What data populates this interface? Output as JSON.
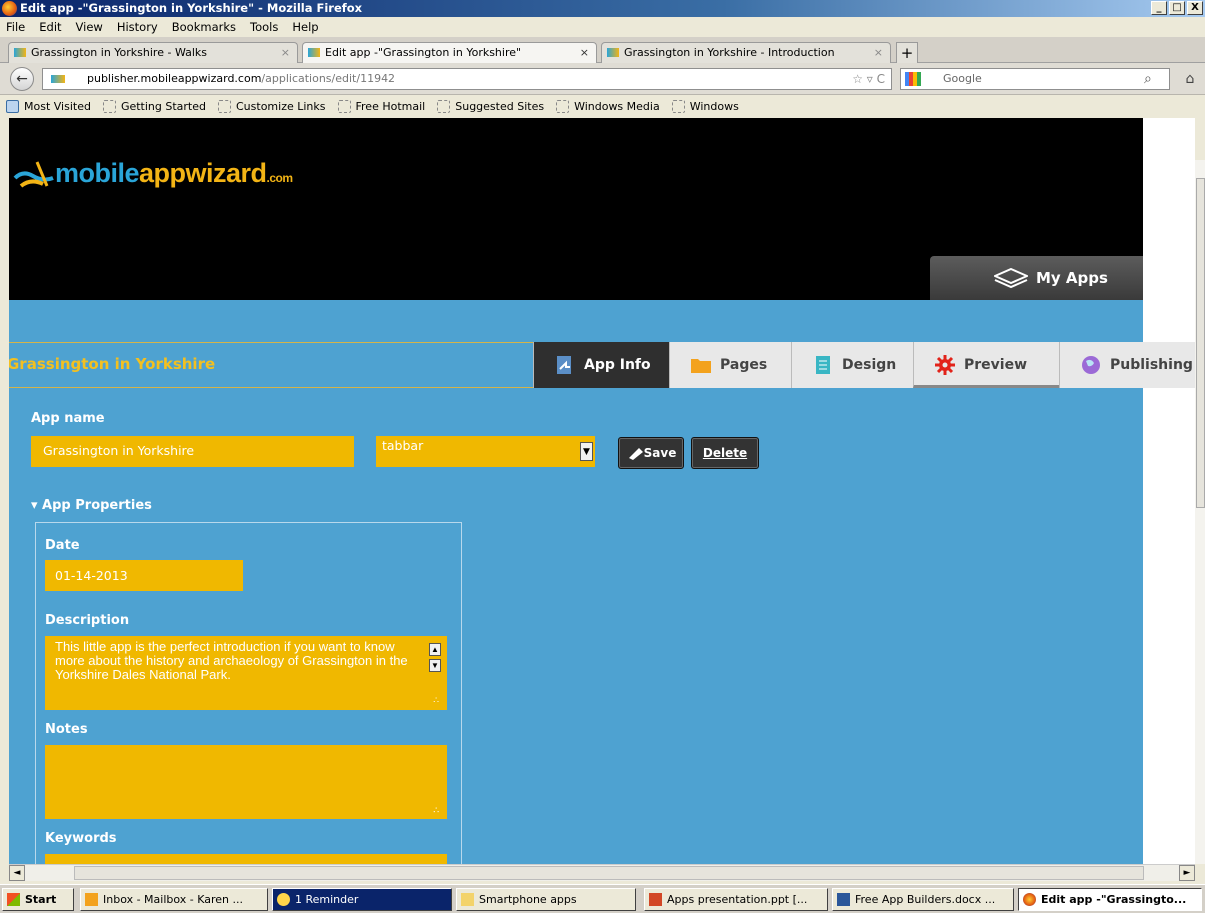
{
  "window": {
    "title": "Edit app -\"Grassington in Yorkshire\" - Mozilla Firefox",
    "buttons": {
      "minimize": "_",
      "maximize": "□",
      "close": "X"
    }
  },
  "menu": [
    "File",
    "Edit",
    "View",
    "History",
    "Bookmarks",
    "Tools",
    "Help"
  ],
  "tabs": [
    {
      "label": "Grassington in Yorkshire - Walks",
      "active": false
    },
    {
      "label": "Edit app -\"Grassington in Yorkshire\"",
      "active": true
    },
    {
      "label": "Grassington in Yorkshire - Introduction",
      "active": false
    }
  ],
  "tab_close": "×",
  "new_tab": "+",
  "nav": {
    "back": "←",
    "url_host": "publisher.mobileappwizard.com",
    "url_path": "/applications/edit/11942",
    "url_icons": "☆ ▿ C",
    "search_placeholder": "Google",
    "search_icon": "⌕",
    "home": "⌂"
  },
  "bookmarks": [
    "Most Visited",
    "Getting Started",
    "Customize Links",
    "Free Hotmail",
    "Suggested Sites",
    "Windows Media",
    "Windows"
  ],
  "site": {
    "logo_main": "mobile",
    "logo_app": "appwizard",
    "logo_com": ".com",
    "my_apps": "My Apps"
  },
  "app": {
    "title": "Grassington in Yorkshire",
    "tabs": [
      {
        "label": "App Info",
        "active": true
      },
      {
        "label": "Pages",
        "active": false
      },
      {
        "label": "Design",
        "active": false
      },
      {
        "label": "Preview",
        "active": false
      },
      {
        "label": "Publishing",
        "active": false
      }
    ],
    "app_name_label": "App name",
    "app_name_value": "Grassington in Yorkshire",
    "style_value": "tabbar",
    "style_arrow": "▼",
    "save_label": "Save",
    "delete_label": "Delete",
    "properties_label": "▾ App Properties",
    "date_label": "Date",
    "date_value": "01-14-2013",
    "description_label": "Description",
    "description_value": "This little app is the perfect introduction if you want to know more about the history and archaeology of Grassington in the Yorkshire Dales National Park.",
    "scroll_up": "▲",
    "scroll_down": "▼",
    "notes_label": "Notes",
    "notes_value": "",
    "keywords_label": "Keywords",
    "grip": "∴"
  },
  "hscroll": {
    "left": "◄",
    "right": "►"
  },
  "taskbar": {
    "start": "Start",
    "items": [
      {
        "label": "Inbox - Mailbox - Karen ..."
      },
      {
        "label": "1 Reminder"
      },
      {
        "label": "Smartphone apps"
      },
      {
        "label": "Apps presentation.ppt [..."
      },
      {
        "label": "Free App Builders.docx ..."
      },
      {
        "label": "Edit app -\"Grassingto..."
      }
    ]
  },
  "colors": {
    "page_bg": "#4ea2d1",
    "field_yellow": "#f0b800",
    "title_yellow": "#f3c020",
    "header_black": "#000000"
  }
}
